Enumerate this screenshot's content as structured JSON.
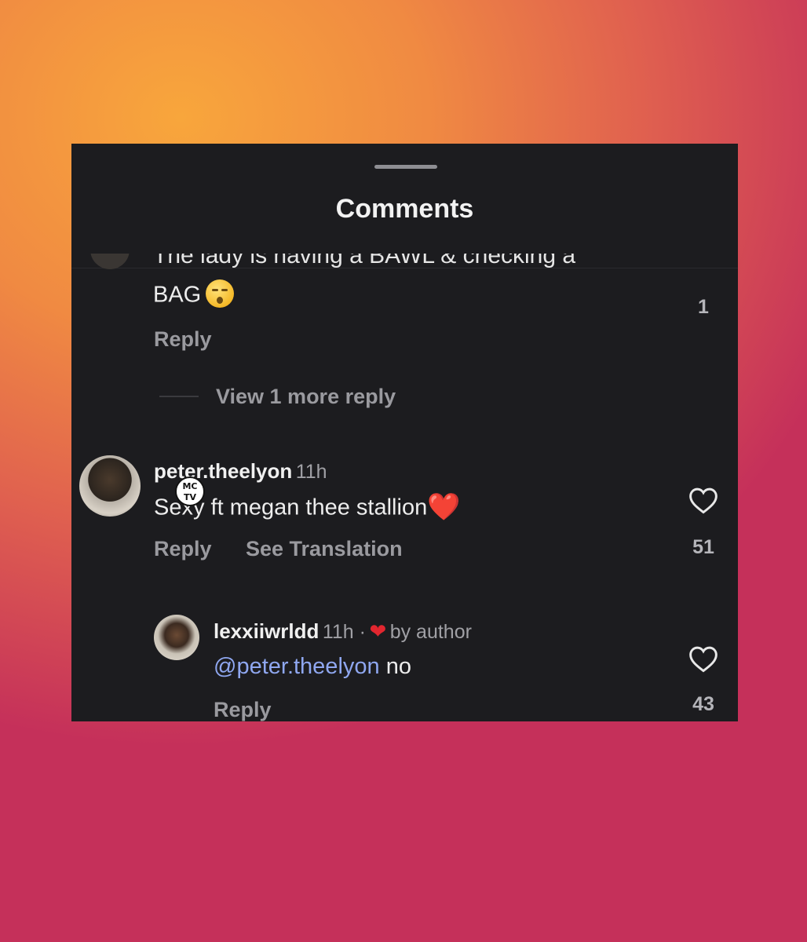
{
  "header": {
    "title": "Comments"
  },
  "comments": [
    {
      "text_top": "The lady is having a BAWL & checking a",
      "text": "BAG",
      "emoji": "flushed-face",
      "reply_label": "Reply",
      "likes": "1",
      "view_replies": "View 1 more reply"
    },
    {
      "username": "peter.theelyon",
      "time": "11h",
      "text": "Sexy ft megan thee stallion",
      "emoji": "❤️",
      "reply_label": "Reply",
      "translate_label": "See Translation",
      "likes": "51",
      "watermark": "MC TV"
    },
    {
      "username": "lexxiiwrldd",
      "time": "11h ·",
      "liked_by": "by author",
      "mention": "@peter.theelyon",
      "text": " no",
      "reply_label": "Reply",
      "likes": "43"
    }
  ],
  "colors": {
    "background_top": "#f8a63c",
    "background_bottom": "#c5305a",
    "panel": "#1c1c1f",
    "mention": "#8fa7f0",
    "heart": "#e2262f"
  }
}
